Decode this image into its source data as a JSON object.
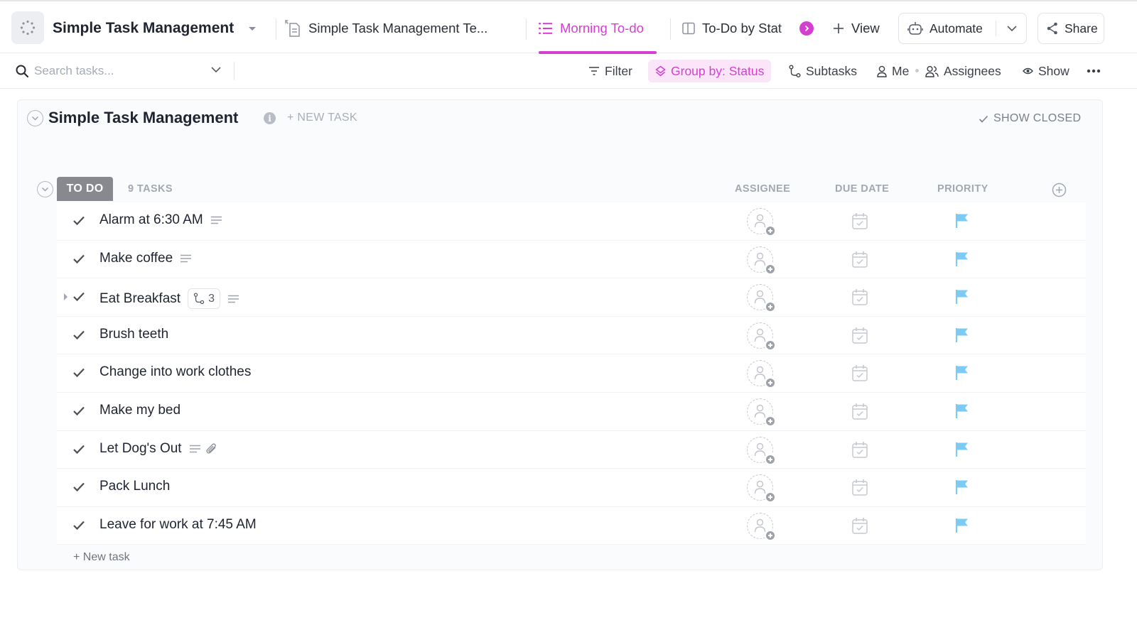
{
  "header": {
    "title": "Simple Task Management",
    "tabs": [
      {
        "label": "Simple Task Management Te...",
        "icon": "doc-icon"
      },
      {
        "label": "Morning To-do",
        "icon": "list-icon",
        "active": true
      },
      {
        "label": "To-Do by Stat",
        "icon": "board-icon"
      }
    ],
    "view_label": "View",
    "automate_label": "Automate",
    "share_label": "Share"
  },
  "toolbar": {
    "search_placeholder": "Search tasks...",
    "filter_label": "Filter",
    "groupby_label": "Group by: Status",
    "subtasks_label": "Subtasks",
    "me_label": "Me",
    "assignees_label": "Assignees",
    "show_label": "Show"
  },
  "list": {
    "title": "Simple Task Management",
    "new_task_label": "+ NEW TASK",
    "show_closed_label": "SHOW CLOSED"
  },
  "group": {
    "status": "TO DO",
    "status_color": "#87898e",
    "count_label": "9 TASKS",
    "columns": {
      "assignee": "ASSIGNEE",
      "due_date": "DUE DATE",
      "priority": "PRIORITY"
    },
    "new_task_label": "+ New task",
    "priority_color": "#7ccbf5"
  },
  "tasks": [
    {
      "name": "Alarm at 6:30 AM",
      "has_description": true
    },
    {
      "name": "Make coffee",
      "has_description": true
    },
    {
      "name": "Eat Breakfast",
      "has_description": true,
      "subtasks": "3",
      "expandable": true
    },
    {
      "name": "Brush teeth"
    },
    {
      "name": "Change into work clothes"
    },
    {
      "name": "Make my bed"
    },
    {
      "name": "Let Dog's Out",
      "has_description": true,
      "has_attachment": true
    },
    {
      "name": "Pack Lunch"
    },
    {
      "name": "Leave for work at 7:45 AM"
    }
  ],
  "colors": {
    "accent": "#d43fd0"
  }
}
